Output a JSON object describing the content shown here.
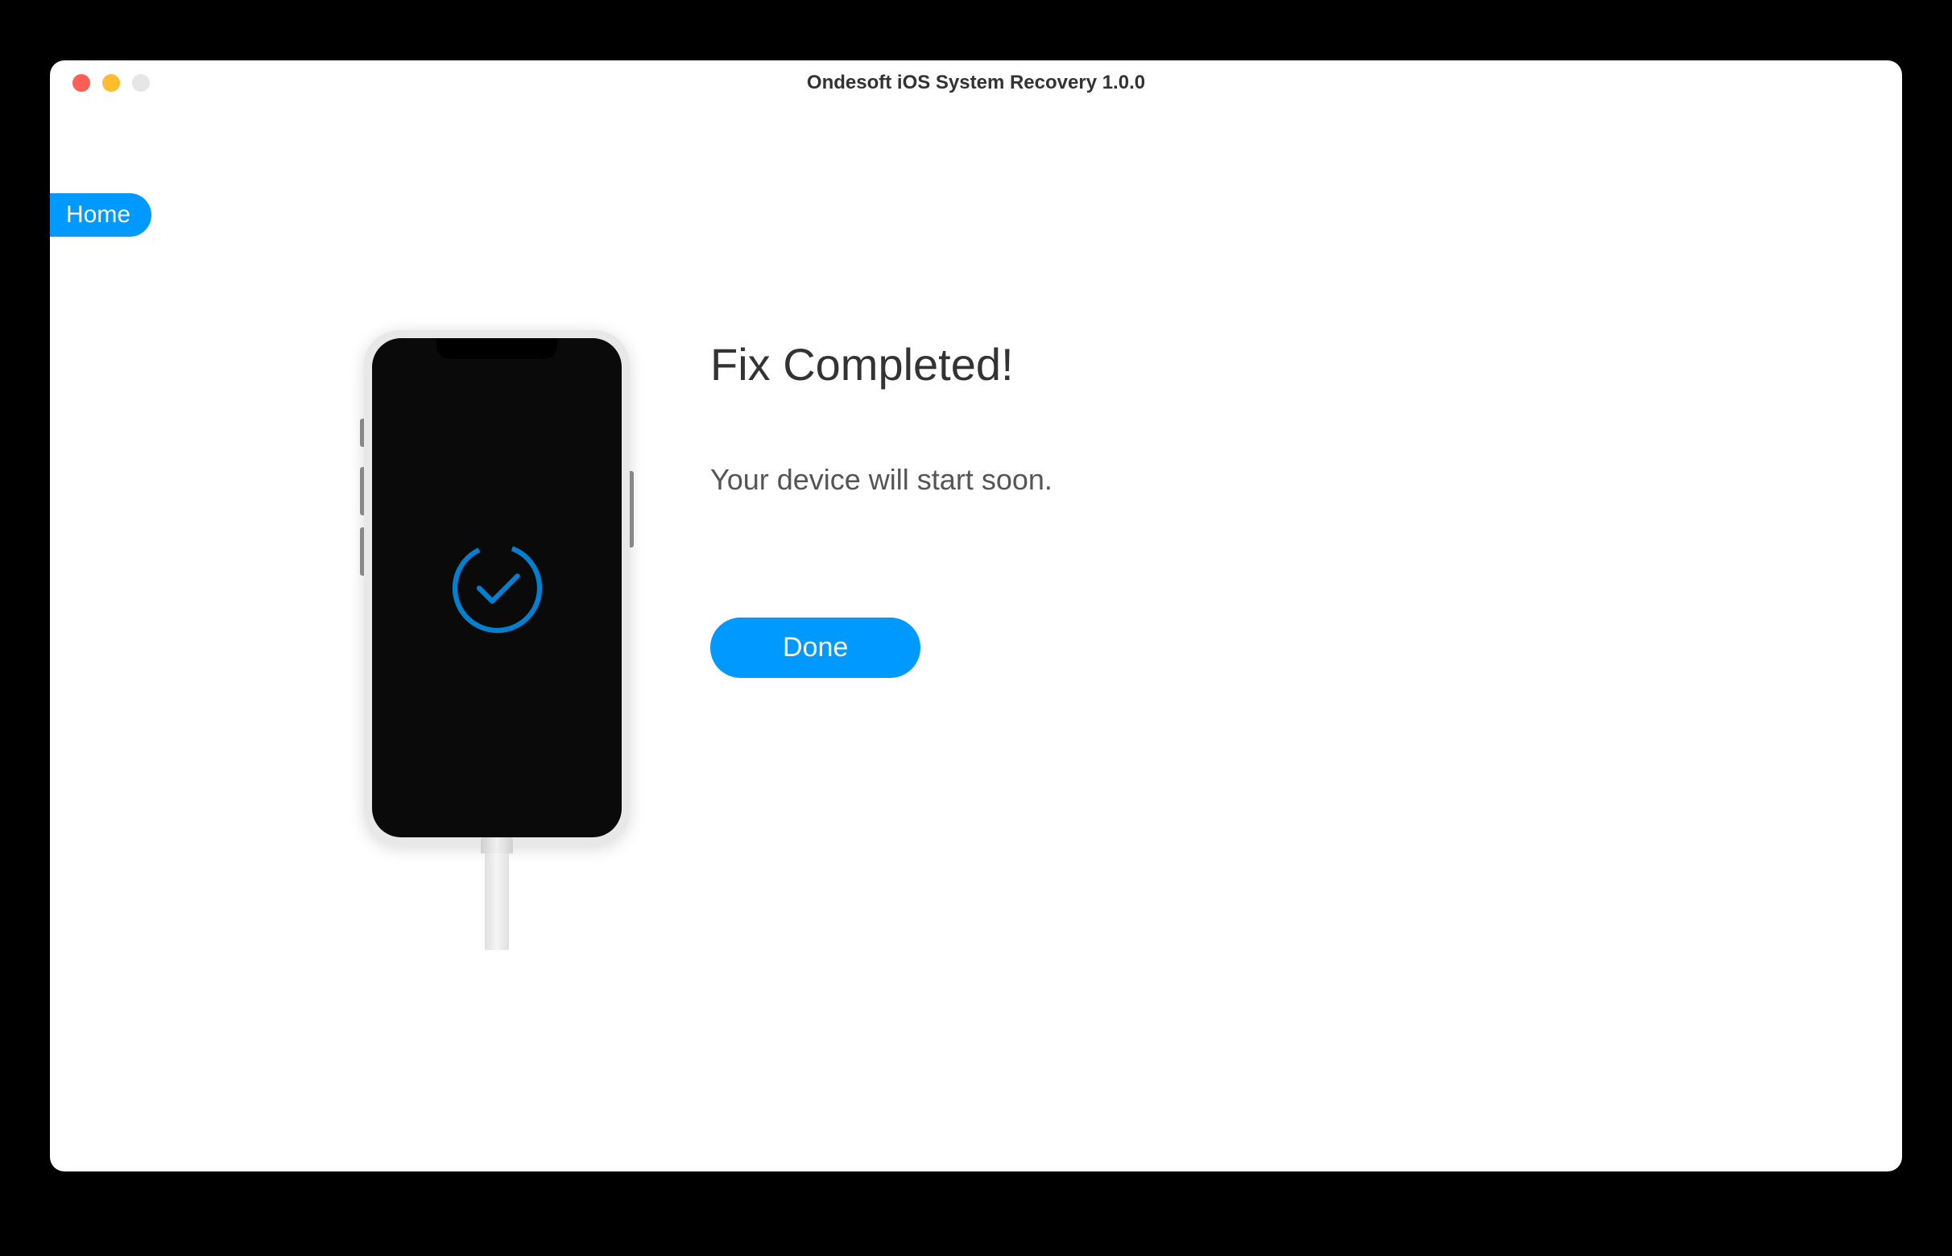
{
  "window": {
    "title": "Ondesoft iOS System Recovery 1.0.0"
  },
  "nav": {
    "home_label": "Home"
  },
  "main": {
    "heading": "Fix Completed!",
    "subtext": "Your device will start soon.",
    "done_label": "Done"
  },
  "colors": {
    "accent": "#0099ff"
  }
}
